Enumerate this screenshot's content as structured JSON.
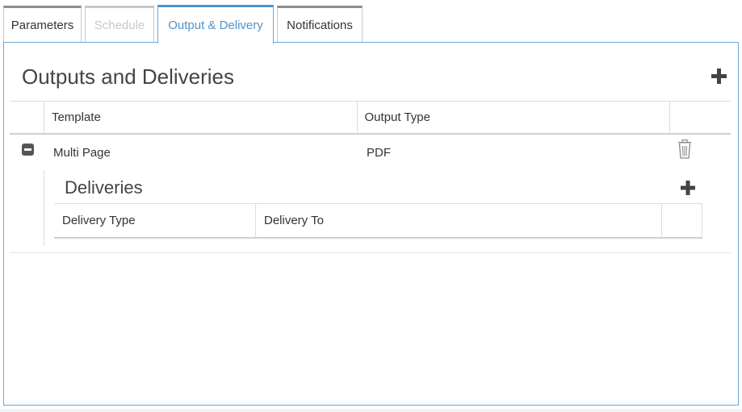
{
  "tabs": [
    {
      "label": "Parameters",
      "state": "normal"
    },
    {
      "label": "Schedule",
      "state": "disabled"
    },
    {
      "label": "Output & Delivery",
      "state": "active"
    },
    {
      "label": "Notifications",
      "state": "normal"
    }
  ],
  "panel": {
    "title": "Outputs and Deliveries",
    "add_icon": "plus-icon"
  },
  "outputs_table": {
    "columns": [
      "Template",
      "Output Type"
    ],
    "rows": [
      {
        "template": "Multi Page",
        "output_type": "PDF",
        "expand_icon": "minus-square-icon",
        "delete_icon": "trash-icon",
        "deliveries": {
          "title": "Deliveries",
          "add_icon": "plus-icon",
          "columns": [
            "Delivery Type",
            "Delivery To"
          ]
        }
      }
    ]
  },
  "colors": {
    "accent": "#4d95c9",
    "border_active": "#6aaad6",
    "text": "#333333",
    "icon": "#444444"
  }
}
